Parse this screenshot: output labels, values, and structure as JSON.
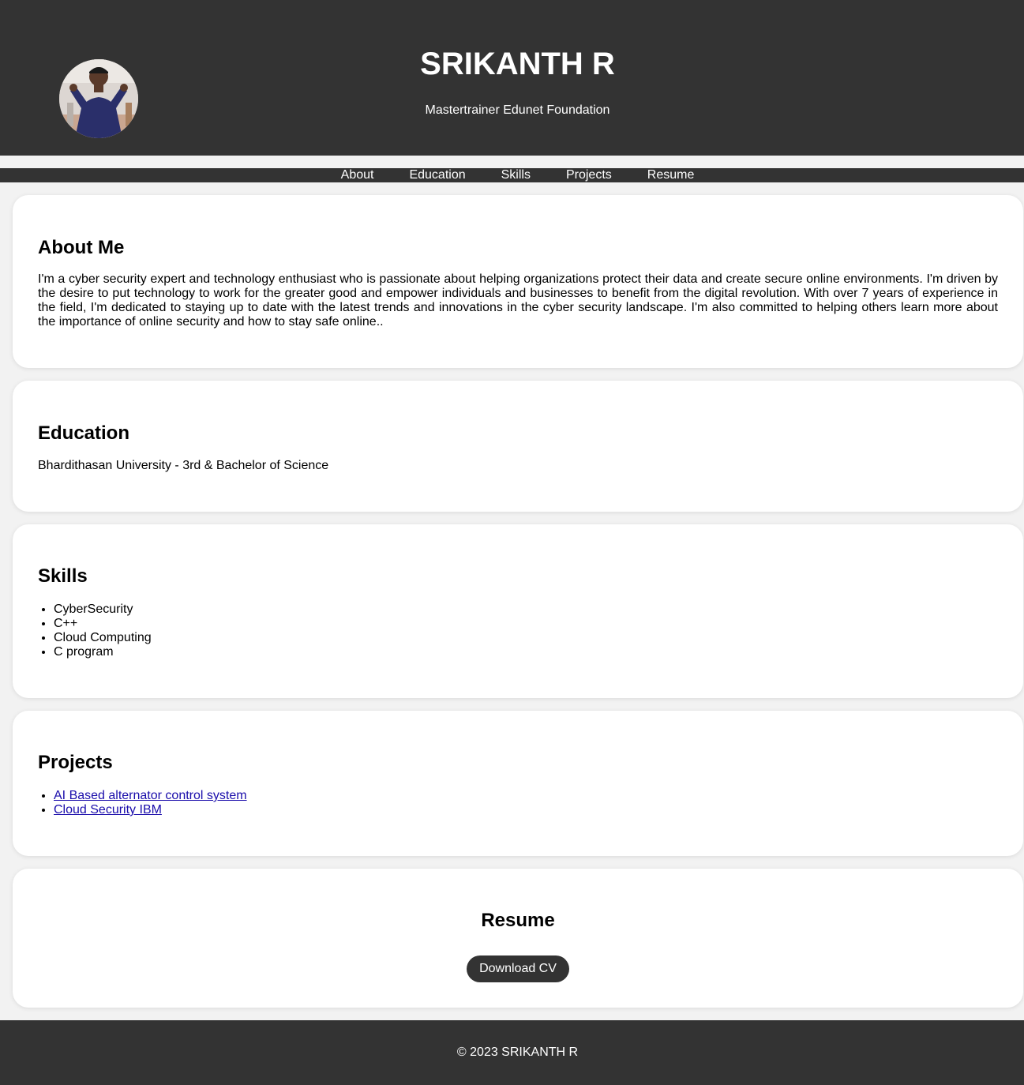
{
  "header": {
    "name": "SRIKANTH R",
    "subtitle": "Mastertrainer Edunet Foundation"
  },
  "nav": {
    "items": [
      "About",
      "Education",
      "Skills",
      "Projects",
      "Resume"
    ]
  },
  "about": {
    "heading": "About Me",
    "text": "I'm a cyber security expert and technology enthusiast who is passionate about helping organizations protect their data and create secure online environments. I'm driven by the desire to put technology to work for the greater good and empower individuals and businesses to benefit from the digital revolution. With over 7 years of experience in the field, I'm dedicated to staying up to date with the latest trends and innovations in the cyber security landscape. I'm also committed to helping others learn more about the importance of online security and how to stay safe online.."
  },
  "education": {
    "heading": "Education",
    "text": "Bhardithasan University - 3rd & Bachelor of Science"
  },
  "skills": {
    "heading": "Skills",
    "items": [
      "CyberSecurity",
      "C++",
      "Cloud Computing",
      "C program"
    ]
  },
  "projects": {
    "heading": "Projects",
    "items": [
      "AI Based alternator control system",
      "Cloud Security IBM"
    ]
  },
  "resume": {
    "heading": "Resume",
    "button_label": "Download CV"
  },
  "footer": {
    "text": "© 2023 SRIKANTH R"
  },
  "colors": {
    "header_bg": "#333333",
    "page_bg": "#f2f2f2",
    "card_bg": "#ffffff",
    "link": "#1a0dab"
  }
}
